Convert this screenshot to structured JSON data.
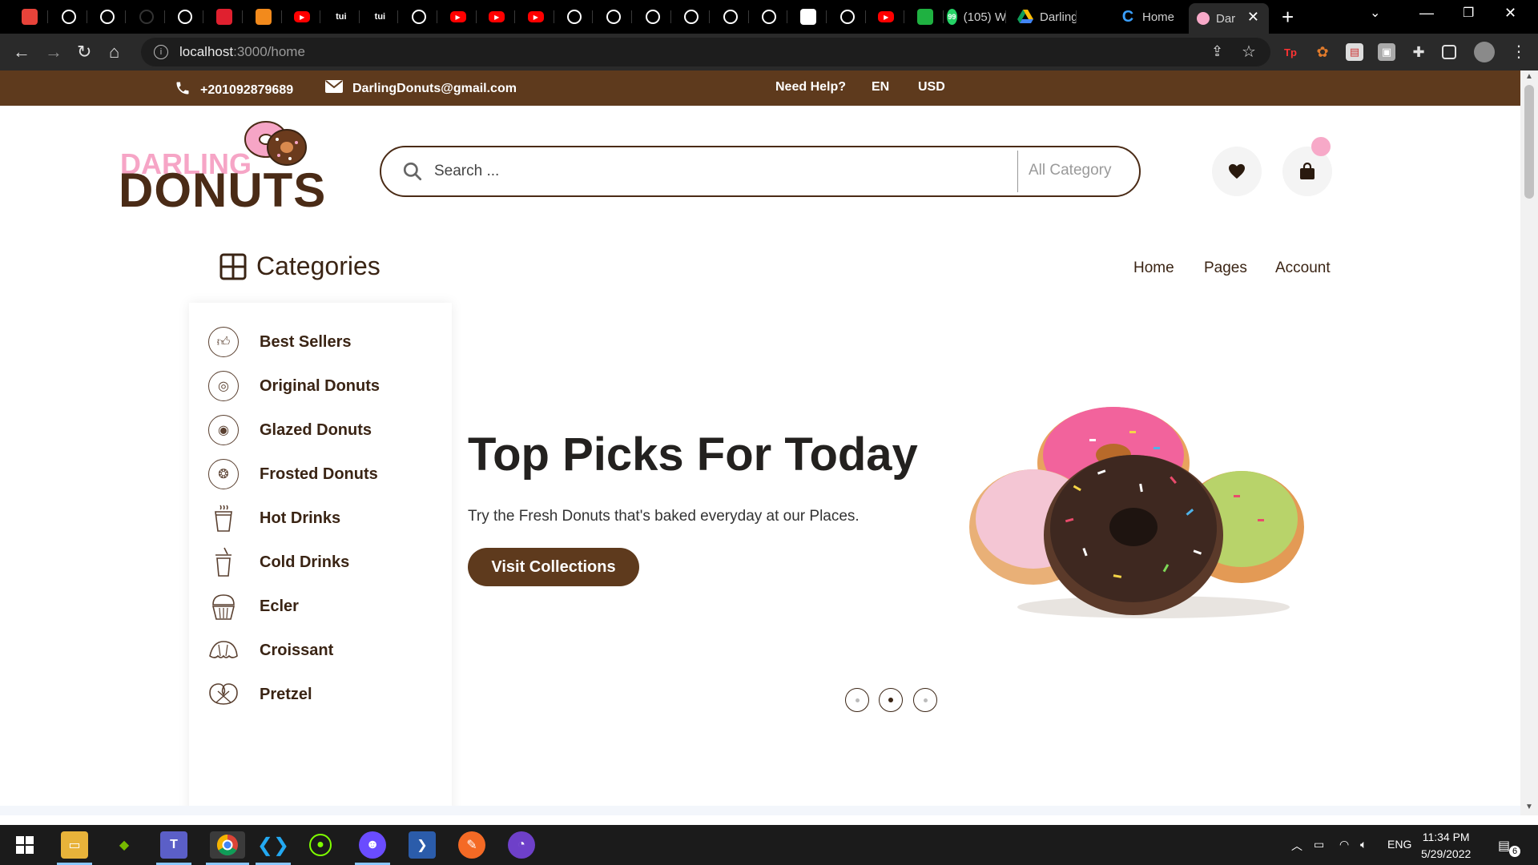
{
  "browser": {
    "tabs": [
      {
        "icon": "multi-icon",
        "color": "#e8433a"
      },
      {
        "icon": "github-icon",
        "color": "#ffffff"
      },
      {
        "icon": "github-icon",
        "color": "#ffffff"
      },
      {
        "icon": "github-icon",
        "color": "#333333"
      },
      {
        "icon": "github-icon",
        "color": "#ffffff"
      },
      {
        "icon": "app-icon",
        "color": "#e0202f"
      },
      {
        "icon": "cube-icon",
        "color": "#f28a1c"
      },
      {
        "icon": "youtube-icon",
        "color": "#ff0000"
      },
      {
        "icon": "tui-icon",
        "label": "tui"
      },
      {
        "icon": "tui-icon",
        "label": "tui"
      },
      {
        "icon": "github-icon",
        "color": "#ffffff"
      },
      {
        "icon": "youtube-icon",
        "color": "#ff0000"
      },
      {
        "icon": "youtube-icon",
        "color": "#ff0000"
      },
      {
        "icon": "youtube-icon",
        "color": "#ff0000"
      },
      {
        "icon": "github-icon",
        "color": "#ffffff"
      },
      {
        "icon": "github-icon",
        "color": "#ffffff"
      },
      {
        "icon": "github-icon",
        "color": "#ffffff"
      },
      {
        "icon": "github-icon",
        "color": "#ffffff"
      },
      {
        "icon": "github-icon",
        "color": "#ffffff"
      },
      {
        "icon": "github-icon",
        "color": "#ffffff"
      },
      {
        "icon": "nextjs-icon",
        "color": "#ffffff"
      },
      {
        "icon": "github-icon",
        "color": "#ffffff"
      },
      {
        "icon": "youtube-icon",
        "color": "#ff0000"
      },
      {
        "icon": "l-icon",
        "color": "#1fb141"
      }
    ],
    "wide_tabs": [
      {
        "label": "(105) W",
        "icon": "whatsapp-icon"
      },
      {
        "label": "Darling",
        "icon": "google-drive-icon"
      },
      {
        "label": "Home",
        "icon": "loading-icon"
      },
      {
        "label": "Dar",
        "icon": "donut-icon"
      }
    ],
    "url_host": "localhost",
    "url_rest": ":3000/home"
  },
  "topbar": {
    "phone": "+201092879689",
    "email": "DarlingDonuts@gmail.com",
    "help": "Need Help?",
    "language": "EN",
    "currency": "USD"
  },
  "logo": {
    "line1": "DARLING",
    "line2": "DONUTS"
  },
  "search": {
    "placeholder": "Search ...",
    "category": "All Category"
  },
  "categories": {
    "title": "Categories",
    "items": [
      {
        "label": "Best Sellers",
        "icon": "thumbs-up-icon"
      },
      {
        "label": "Original Donuts",
        "icon": "donut-icon"
      },
      {
        "label": "Glazed Donuts",
        "icon": "glazed-donut-icon"
      },
      {
        "label": "Frosted Donuts",
        "icon": "frosted-donut-icon"
      },
      {
        "label": "Hot Drinks",
        "icon": "hot-drink-icon"
      },
      {
        "label": "Cold Drinks",
        "icon": "cold-drink-icon"
      },
      {
        "label": "Ecler",
        "icon": "cupcake-icon"
      },
      {
        "label": "Croissant",
        "icon": "croissant-icon"
      },
      {
        "label": "Pretzel",
        "icon": "pretzel-icon"
      }
    ]
  },
  "nav": {
    "home": "Home",
    "pages": "Pages",
    "account": "Account"
  },
  "hero": {
    "title": "Top Picks For Today",
    "subtitle": "Try the Fresh Donuts that's baked everyday at our Places.",
    "button": "Visit Collections",
    "active_slide": 2,
    "slide_count": 3
  },
  "colors": {
    "brand": "#5e3a1d",
    "accent_pink": "#f7a9c8"
  },
  "taskbar": {
    "language": "ENG",
    "time": "11:34 PM",
    "date": "5/29/2022",
    "notifications": "6"
  }
}
